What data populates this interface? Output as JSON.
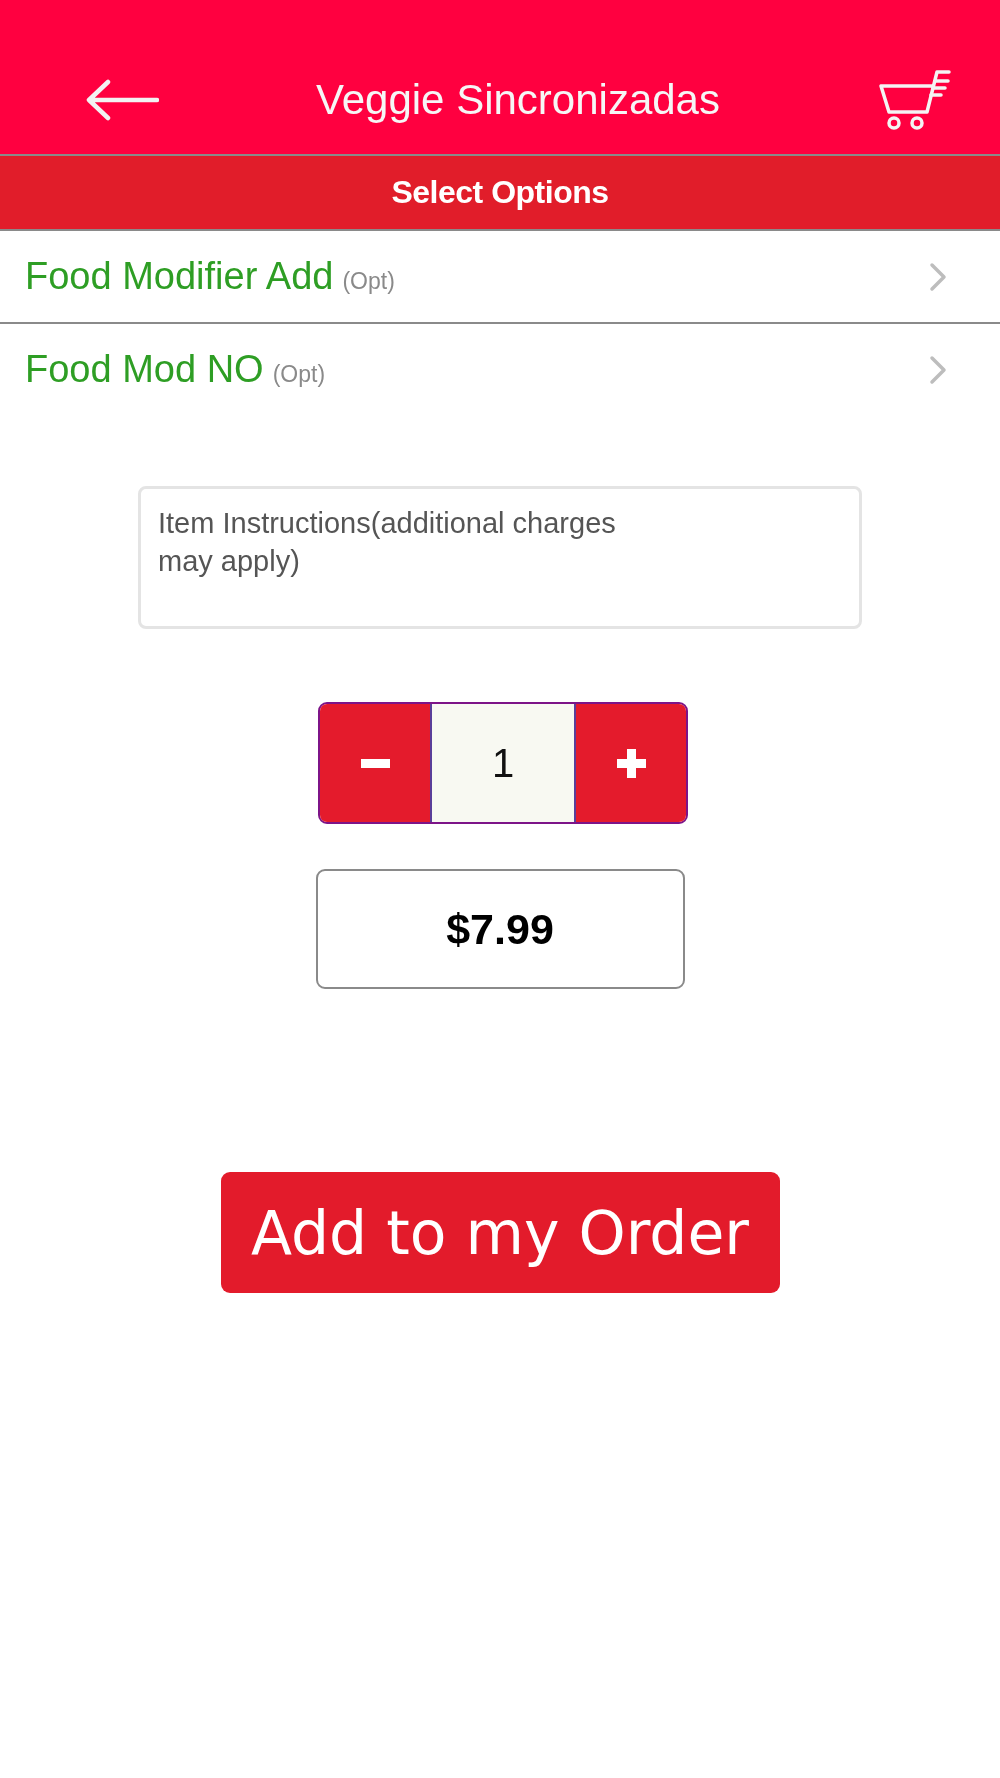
{
  "header": {
    "title": "Veggie Sincronizadas"
  },
  "section_bar": {
    "title": "Select Options"
  },
  "option_groups": [
    {
      "label": "Food Modifier Add",
      "note": "(Opt)"
    },
    {
      "label": "Food Mod NO",
      "note": "(Opt)"
    }
  ],
  "instructions": {
    "placeholder": "Item Instructions(additional charges may apply)"
  },
  "quantity": {
    "value": "1"
  },
  "price": "$7.99",
  "add_button": {
    "label": "Add to my Order"
  }
}
